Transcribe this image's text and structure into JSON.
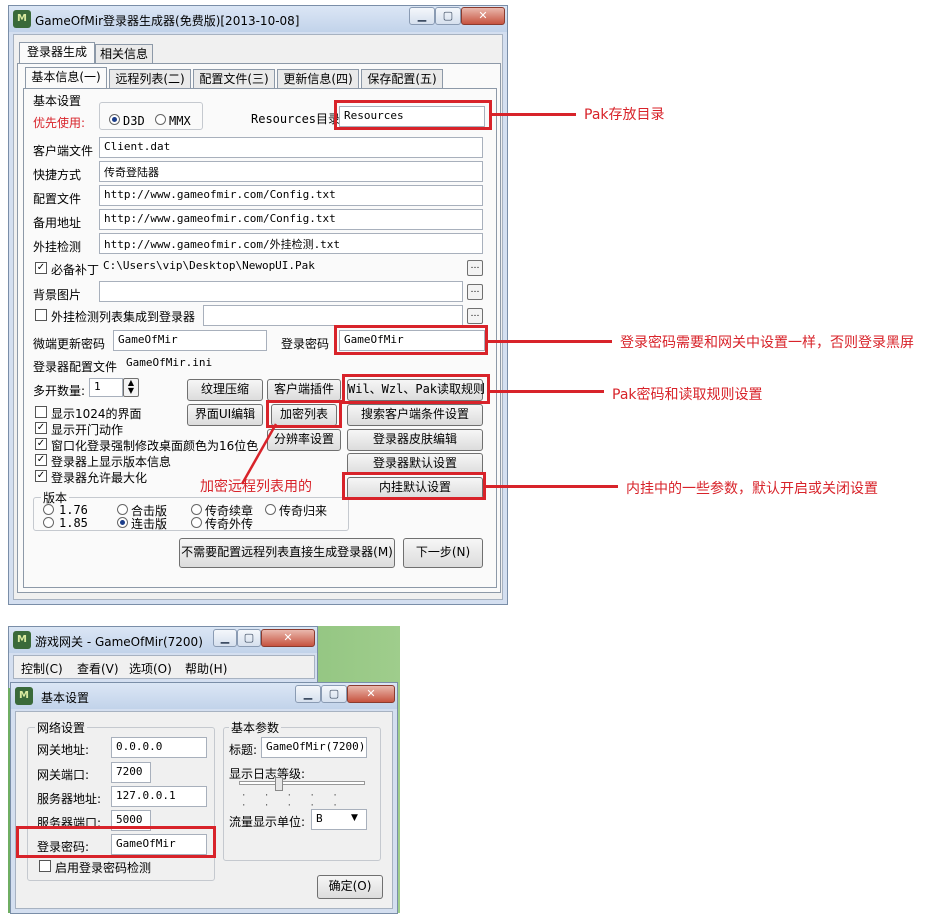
{
  "top_window": {
    "title": "GameOfMir登录器生成器(免费版)[2013-10-08]",
    "outer_tabs": [
      "登录器生成",
      "相关信息"
    ],
    "inner_tabs": [
      "基本信息(一)",
      "远程列表(二)",
      "配置文件(三)",
      "更新信息(四)",
      "保存配置(五)"
    ],
    "section_basic": "基本设置",
    "priority_label": "优先使用:",
    "renderers": [
      "D3D",
      "MMX"
    ],
    "resources_label": "Resources目录:",
    "resources_value": "Resources",
    "fields": [
      {
        "label": "客户端文件",
        "value": "Client.dat"
      },
      {
        "label": "快捷方式",
        "value": "传奇登陆器"
      },
      {
        "label": "配置文件",
        "value": "http://www.gameofmir.com/Config.txt"
      },
      {
        "label": "备用地址",
        "value": "http://www.gameofmir.com/Config.txt"
      },
      {
        "label": "外挂检测",
        "value": "http://www.gameofmir.com/外挂检测.txt"
      }
    ],
    "required_patch_label": "必备补丁",
    "required_patch_value": "C:\\Users\\vip\\Desktop\\NewopUI.Pak",
    "bg_label": "背景图片",
    "plugin_list_label": "外挂检测列表集成到登录器",
    "micro_pwd_label": "微端更新密码",
    "micro_pwd_value": "GameOfMir",
    "login_pwd_label": "登录密码",
    "login_pwd_value": "GameOfMir",
    "config_file_label": "登录器配置文件",
    "config_file_value": "GameOfMir.ini",
    "multi_label": "多开数量:",
    "multi_value": "1",
    "options": [
      "显示1024的界面",
      "显示开门动作",
      "窗口化登录强制修改桌面颜色为16位色",
      "登录器上显示版本信息",
      "登录器允许最大化"
    ],
    "version_label": "版本",
    "versions": [
      "1.76",
      "合击版",
      "传奇续章",
      "传奇归来",
      "1.85",
      "连击版",
      "传奇外传"
    ],
    "buttons": {
      "texture": "纹理压缩",
      "client_plugin": "客户端插件",
      "wil_rule": "Wil、Wzl、Pak读取规则",
      "ui_edit": "界面UI编辑",
      "encrypt_list": "加密列表",
      "search_client": "搜索客户端条件设置",
      "resolution": "分辨率设置",
      "skin_edit": "登录器皮肤编辑",
      "default_settings": "登录器默认设置",
      "plugin_default": "内挂默认设置",
      "generate_direct": "不需要配置远程列表直接生成登录器(M)",
      "next": "下一步(N)"
    }
  },
  "bottom_window": {
    "title": "游戏网关 - GameOfMir(7200)",
    "menu": [
      "控制(C)",
      "查看(V)",
      "选项(O)",
      "帮助(H)"
    ],
    "dialog_title": "基本设置",
    "network_group": "网络设置",
    "gateway_addr_label": "网关地址:",
    "gateway_addr_value": "0.0.0.0",
    "gateway_port_label": "网关端口:",
    "gateway_port_value": "7200",
    "server_addr_label": "服务器地址:",
    "server_addr_value": "127.0.0.1",
    "server_port_label": "服务器端口:",
    "server_port_value": "5000",
    "login_pwd_label": "登录密码:",
    "login_pwd_value": "GameOfMir",
    "enable_pwd_check": "启用登录密码检测",
    "basic_group": "基本参数",
    "title_label": "标题:",
    "title_value": "GameOfMir(7200)",
    "log_level_label": "显示日志等级:",
    "flow_unit_label": "流量显示单位:",
    "flow_unit_value": "B",
    "ok_button": "确定(O)"
  },
  "annotations": {
    "pak_dir": "Pak存放目录",
    "login_pwd": "登录密码需要和网关中设置一样，否则登录黑屏",
    "pak_rule": "Pak密码和读取规则设置",
    "remote_list": "加密远程列表用的",
    "plugin_params": "内挂中的一些参数，默认开启或关闭设置"
  },
  "colors": {
    "annotation": "#d8232a"
  }
}
